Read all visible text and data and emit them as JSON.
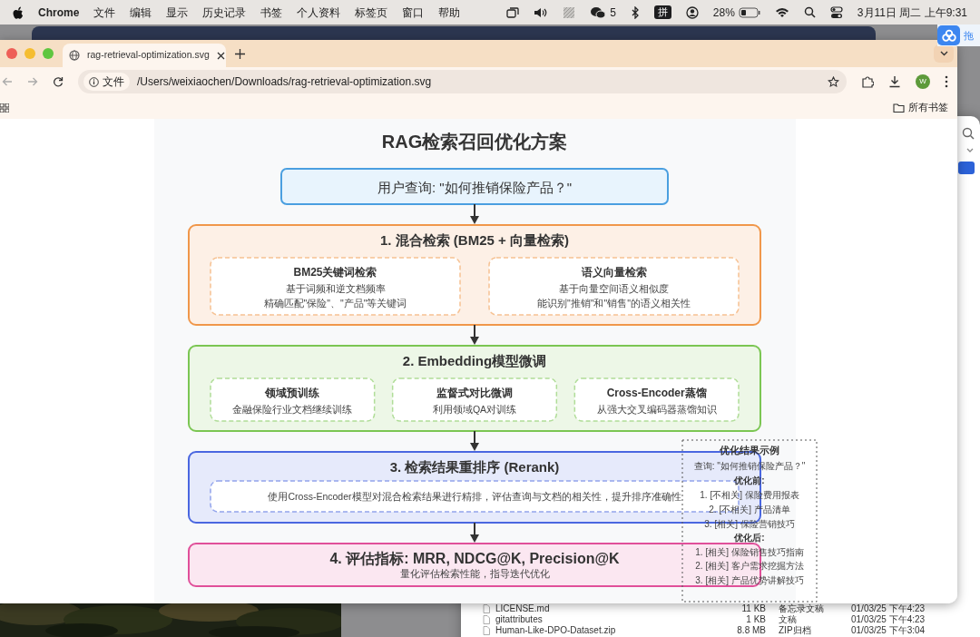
{
  "menubar": {
    "app": "Chrome",
    "menus": [
      "文件",
      "编辑",
      "显示",
      "历史记录",
      "书签",
      "个人资料",
      "标签页",
      "窗口",
      "帮助"
    ],
    "status": {
      "chat_count": "5",
      "input_method": "拼",
      "battery": "28%",
      "datetime": "3月11日 周二 上午9:31"
    }
  },
  "side_panel": {
    "text": "拖"
  },
  "browser": {
    "tabs": [
      {
        "title": "rag-retrieval-optimization.svg",
        "selected": true
      }
    ],
    "address": {
      "chip": "文件",
      "url": "/Users/weixiaochen/Downloads/rag-retrieval-optimization.svg"
    },
    "avatar": "W",
    "bookmarks_folder": "所有书签"
  },
  "diagram": {
    "title": "RAG检索召回优化方案",
    "query": "用户查询: \"如何推销保险产品？\"",
    "stages": [
      {
        "kind": "modules",
        "title": "1. 混合检索 (BM25 + 向量检索)",
        "color": "#f0974a",
        "modules": [
          {
            "title": "BM25关键词检索",
            "lines": [
              "基于词频和逆文档频率",
              "精确匹配\"保险\"、\"产品\"等关键词"
            ]
          },
          {
            "title": "语义向量检索",
            "lines": [
              "基于向量空间语义相似度",
              "能识别\"推销\"和\"销售\"的语义相关性"
            ]
          }
        ]
      },
      {
        "kind": "modules",
        "title": "2. Embedding模型微调",
        "color": "#7bc653",
        "modules": [
          {
            "title": "领域预训练",
            "lines": [
              "金融保险行业文档继续训练"
            ]
          },
          {
            "title": "监督式对比微调",
            "lines": [
              "利用领域QA对训练"
            ]
          },
          {
            "title": "Cross-Encoder蒸馏",
            "lines": [
              "从强大交叉编码器蒸馏知识"
            ]
          }
        ]
      },
      {
        "kind": "description",
        "title": "3. 检索结果重排序 (Rerank)",
        "color": "#4a67e0",
        "text": "使用Cross-Encoder模型对混合检索结果进行精排，评估查询与文档的相关性，提升排序准确性"
      },
      {
        "kind": "subtitle",
        "title": "4. 评估指标: MRR, NDCG@K, Precision@K",
        "color": "#e0509a",
        "text": "量化评估检索性能，指导迭代优化"
      }
    ],
    "example": {
      "title": "优化结果示例",
      "query": "查询: \"如何推销保险产品？\"",
      "before_label": "优化前:",
      "before": [
        "1. [不相关] 保险费用报表",
        "2. [不相关] 产品清单",
        "3. [相关] 保险营销技巧"
      ],
      "after_label": "优化后:",
      "after": [
        "1. [相关] 保险销售技巧指南",
        "2. [相关] 客户需求挖掘方法",
        "3. [相关] 产品优势讲解技巧"
      ]
    }
  },
  "finder": {
    "rows": [
      {
        "name": "LICENSE.md",
        "size": "11 KB",
        "kind": "备忘录文稿",
        "date": "01/03/25 下午4:23"
      },
      {
        "name": "gitattributes",
        "size": "1 KB",
        "kind": "文稿",
        "date": "01/03/25 下午4:23"
      },
      {
        "name": "Human-Like-DPO-Dataset.zip",
        "size": "8.8 MB",
        "kind": "ZIP归档",
        "date": "01/03/25 下午3:04"
      }
    ]
  }
}
